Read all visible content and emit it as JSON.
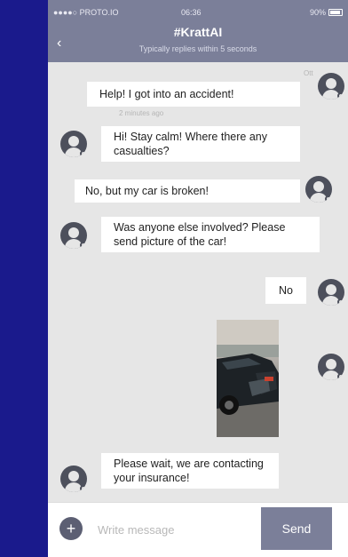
{
  "status_bar": {
    "carrier": "●●●●○ PROTO.IO",
    "time": "06:36",
    "battery": "90%"
  },
  "header": {
    "back": "‹",
    "title": "#KrattAI",
    "subtitle": "Typically replies within 5 seconds"
  },
  "messages": [
    {
      "sender": "user",
      "text": "Help! I got into an accident!",
      "meta_top": "Ott",
      "meta_bottom": "2 minutes ago"
    },
    {
      "sender": "bot",
      "text": "Hi! Stay calm! Where there any casualties?"
    },
    {
      "sender": "user",
      "text": "No, but my car is broken!"
    },
    {
      "sender": "bot",
      "text": "Was anyone else involved? Please send picture of the car!"
    },
    {
      "sender": "user",
      "text": "No"
    },
    {
      "sender": "user",
      "type": "image",
      "description": "photo-car"
    },
    {
      "sender": "bot",
      "text": "Please wait, we are contacting your insurance!"
    }
  ],
  "composer": {
    "add": "+",
    "placeholder": "Write message",
    "send_label": "Send"
  },
  "colors": {
    "background": "#1a1a8c",
    "header": "#7b7f99",
    "chat_bg": "#e6e6e6",
    "avatar": "#4d505c"
  }
}
